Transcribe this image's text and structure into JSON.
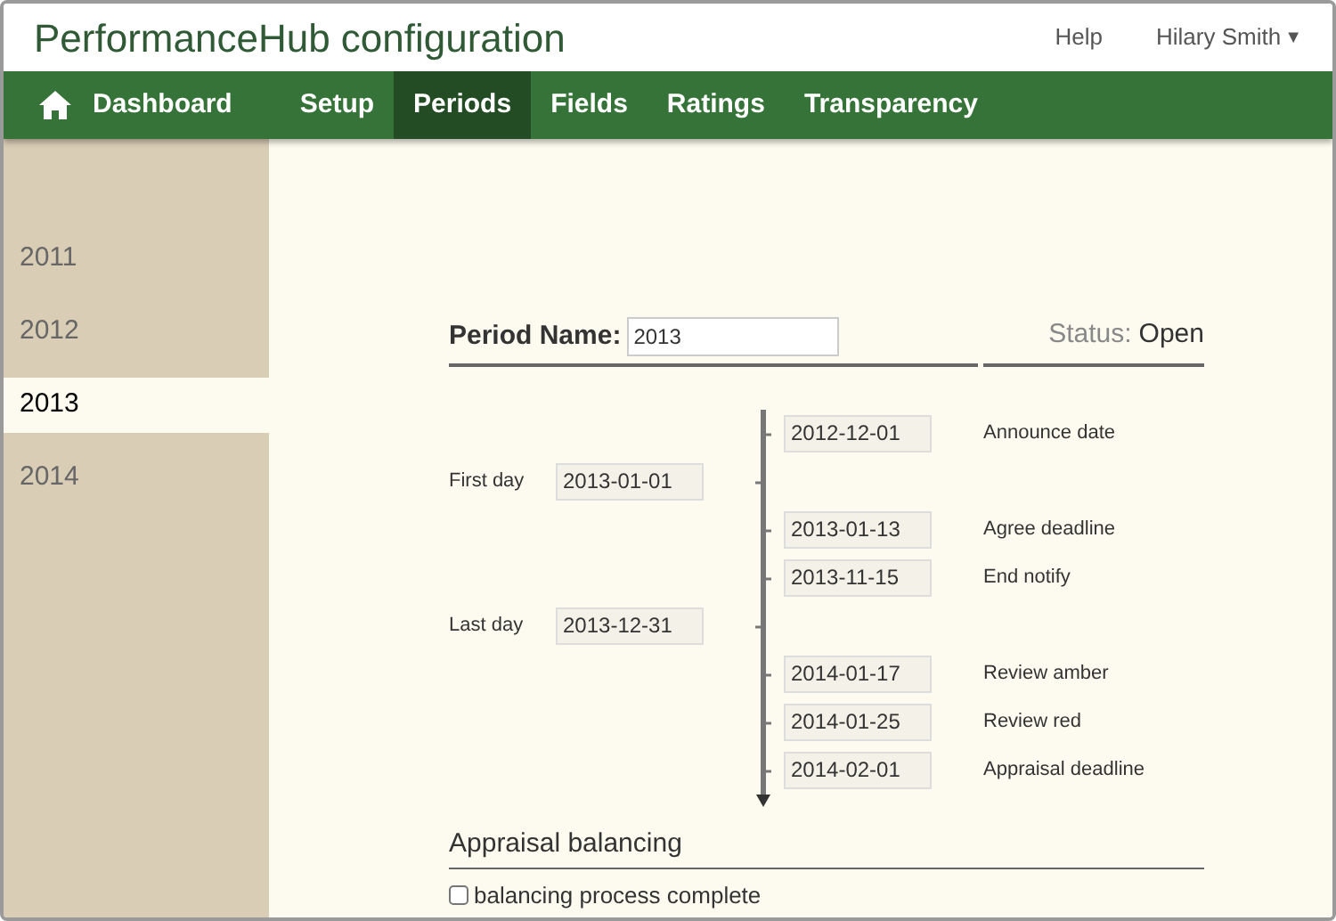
{
  "header": {
    "title": "PerformanceHub configuration",
    "links": [
      "Help"
    ],
    "user": "Hilary Smith",
    "user_caret": "▼"
  },
  "nav": [
    {
      "label": "Dashboard",
      "selected": false
    },
    {
      "label": "Setup",
      "selected": false
    },
    {
      "label": "Periods",
      "selected": true
    },
    {
      "label": "Fields",
      "selected": false
    },
    {
      "label": "Ratings",
      "selected": false
    },
    {
      "label": "Transparency",
      "selected": false
    }
  ],
  "sidebar": {
    "items": [
      {
        "label": "2011",
        "selected": false
      },
      {
        "label": "2012",
        "selected": false
      },
      {
        "label": "2013",
        "selected": true
      },
      {
        "label": "2014",
        "selected": false
      }
    ]
  },
  "period": {
    "name_label": "Period Name:",
    "name_value": "2013",
    "status_label": "Status:",
    "status_value": "Open"
  },
  "timeline": [
    {
      "kind": "milestone",
      "date": "2012-12-01",
      "label": "Announce date"
    },
    {
      "kind": "boundary",
      "date": "2013-01-01",
      "label": "First day"
    },
    {
      "kind": "milestone",
      "date": "2013-01-13",
      "label": "Agree deadline"
    },
    {
      "kind": "milestone",
      "date": "2013-11-15",
      "label": "End notify"
    },
    {
      "kind": "boundary",
      "date": "2013-12-31",
      "label": "Last day"
    },
    {
      "kind": "milestone",
      "date": "2014-01-17",
      "label": "Review amber"
    },
    {
      "kind": "milestone",
      "date": "2014-01-25",
      "label": "Review red"
    },
    {
      "kind": "milestone",
      "date": "2014-02-01",
      "label": "Appraisal deadline"
    }
  ],
  "balancing": {
    "heading": "Appraisal balancing",
    "label": "balancing process complete",
    "checked": false
  }
}
